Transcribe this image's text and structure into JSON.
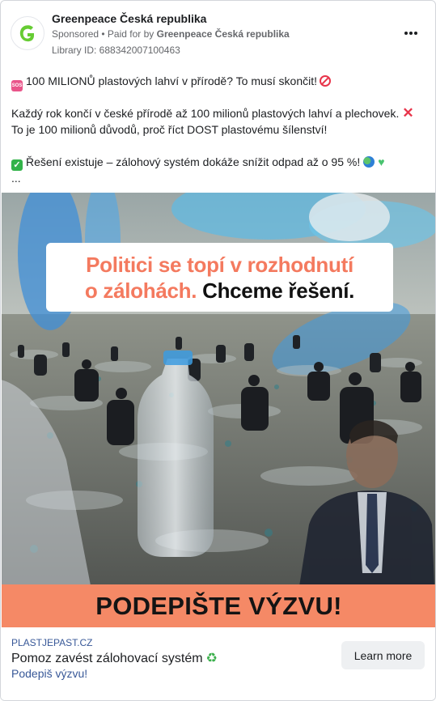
{
  "header": {
    "page_name": "Greenpeace Česká republika",
    "sponsored": "Sponsored",
    "paid_for_prefix": " • Paid for by ",
    "paid_for_by": "Greenpeace Česká republika",
    "library_id": "Library ID: 688342007100463"
  },
  "post": {
    "line1": "100 MILIONŮ plastových lahví v přírodě? To musí skončit!",
    "line2": "Každý rok končí v české přírodě až 100 milionů plastových lahví a plechovek.",
    "line3": "To je 100 milionů důvodů, proč říct DOST plastovému šílenství!",
    "line4": "Řešení existuje – zálohový systém dokáže snížit odpad až o 95 %!",
    "ellipsis": "..."
  },
  "image": {
    "headline_orange_1": "Politici se topí v rozhodnutí",
    "headline_orange_2": "o zálohách.",
    "headline_dark": "Chceme řešení.",
    "cta_band": "PODEPIŠTE VÝZVU!"
  },
  "footer": {
    "domain": "PLASTJEPAST.CZ",
    "title": "Pomoz zavést zálohovací systém",
    "subtitle": "Podepiš výzvu!",
    "button": "Learn more"
  },
  "icons": {
    "avatar": "greenpeace-g-logo",
    "more": "more-options-icon",
    "sos": "sos-emoji",
    "no_entry": "no-entry-emoji",
    "cross": "cross-mark-emoji",
    "check": "check-mark-emoji",
    "globe": "globe-emoji",
    "heart": "green-heart-emoji",
    "recycle": "recycle-emoji"
  },
  "colors": {
    "accent_orange": "#f47a5f",
    "cta_band": "#f58966",
    "brand_green": "#66cc33",
    "link_blue": "#385898"
  }
}
